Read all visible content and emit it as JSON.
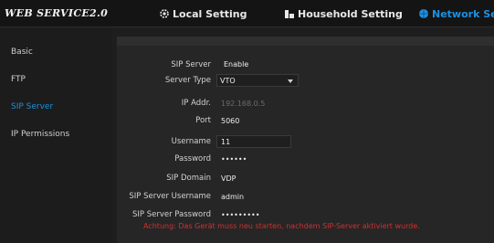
{
  "header": {
    "logo": "WEB SERVICE2.0",
    "tabs": [
      {
        "label": "Local Setting"
      },
      {
        "label": "Household Setting"
      },
      {
        "label": "Network Setti"
      }
    ]
  },
  "sidebar": {
    "items": [
      {
        "label": "Basic"
      },
      {
        "label": "FTP"
      },
      {
        "label": "SIP Server"
      },
      {
        "label": "IP Permissions"
      }
    ]
  },
  "form": {
    "sip_server": {
      "label": "SIP Server",
      "value": "Enable"
    },
    "server_type": {
      "label": "Server Type",
      "value": "VTO"
    },
    "ip_addr": {
      "label": "IP Addr.",
      "value": "192.168.0.5"
    },
    "port": {
      "label": "Port",
      "value": "5060"
    },
    "username": {
      "label": "Username",
      "value": "11"
    },
    "password": {
      "label": "Password",
      "value": "••••••"
    },
    "sip_domain": {
      "label": "SIP Domain",
      "value": "VDP"
    },
    "sip_server_username": {
      "label": "SIP Server Username",
      "value": "admin"
    },
    "sip_server_password": {
      "label": "SIP Server Password",
      "value": "•••••••••"
    }
  },
  "warning": "Achtung: Das Gerät muss neu starten, nachdem SIP-Server aktiviert wurde.",
  "colors": {
    "accent": "#1e90e0",
    "warning": "#d62d2d"
  }
}
